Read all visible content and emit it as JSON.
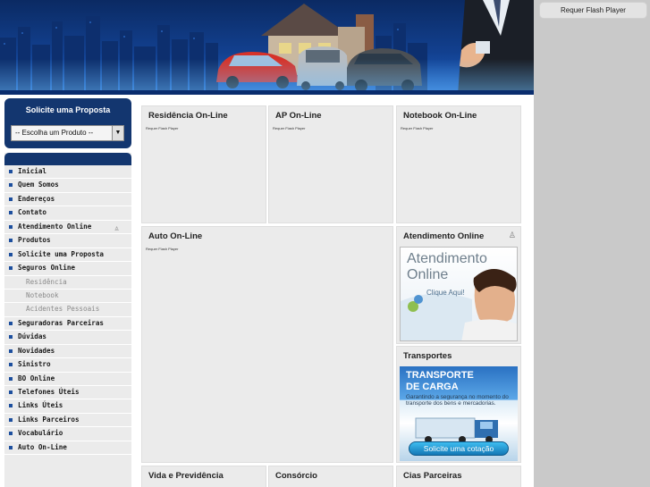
{
  "header": {
    "flash_notice": "Requer Flash Player"
  },
  "proposal": {
    "title": "Solicite uma Proposta",
    "select_value": "-- Escolha um Produto --"
  },
  "menu": {
    "items": [
      {
        "label": "Inicial",
        "sub": false
      },
      {
        "label": "Quem Somos",
        "sub": false
      },
      {
        "label": "Endereços",
        "sub": false
      },
      {
        "label": "Contato",
        "sub": false
      },
      {
        "label": "Atendimento Online",
        "sub": false,
        "icon": "user-icon"
      },
      {
        "label": "Produtos",
        "sub": false
      },
      {
        "label": "Solicite uma Proposta",
        "sub": false
      },
      {
        "label": "Seguros Online",
        "sub": false
      },
      {
        "label": "Residência",
        "sub": true
      },
      {
        "label": "Notebook",
        "sub": true
      },
      {
        "label": "Acidentes Pessoais",
        "sub": true
      },
      {
        "label": "Seguradoras Parceiras",
        "sub": false
      },
      {
        "label": "Dúvidas",
        "sub": false
      },
      {
        "label": "Novidades",
        "sub": false
      },
      {
        "label": "Sinistro",
        "sub": false
      },
      {
        "label": "BO Online",
        "sub": false
      },
      {
        "label": "Telefones Úteis",
        "sub": false
      },
      {
        "label": "Links Úteis",
        "sub": false
      },
      {
        "label": "Links Parceiros",
        "sub": false
      },
      {
        "label": "Vocabulário",
        "sub": false
      },
      {
        "label": "Auto On-Line",
        "sub": false
      }
    ]
  },
  "panels": {
    "residencia": {
      "title": "Residência On-Line",
      "flash": "Requer Flash Player"
    },
    "ap": {
      "title": "AP On-Line",
      "flash": "Requer Flash Player"
    },
    "notebook": {
      "title": "Notebook On-Line",
      "flash": "Requer Flash Player"
    },
    "auto": {
      "title": "Auto On-Line",
      "flash": "Requer Flash Player"
    },
    "atendimento": {
      "title": "Atendimento Online",
      "line1": "Atendimento",
      "line2": "Online",
      "click": "Clique Aqui!"
    },
    "transportes": {
      "title": "Transportes",
      "banner_l1": "TRANSPORTE",
      "banner_l2": "DE CARGA",
      "banner_desc": "Garantindo a segurança no momento do transporte dos bens e mercadorias.",
      "button": "Solicite uma cotação"
    },
    "vida": {
      "title": "Vida e Previdência"
    },
    "consorcio": {
      "title": "Consórcio"
    },
    "cias": {
      "title": "Cias Parceiras"
    }
  },
  "colors": {
    "navy": "#13366f",
    "panel_bg": "#ebebeb",
    "accent_blue": "#1d4f9e"
  }
}
